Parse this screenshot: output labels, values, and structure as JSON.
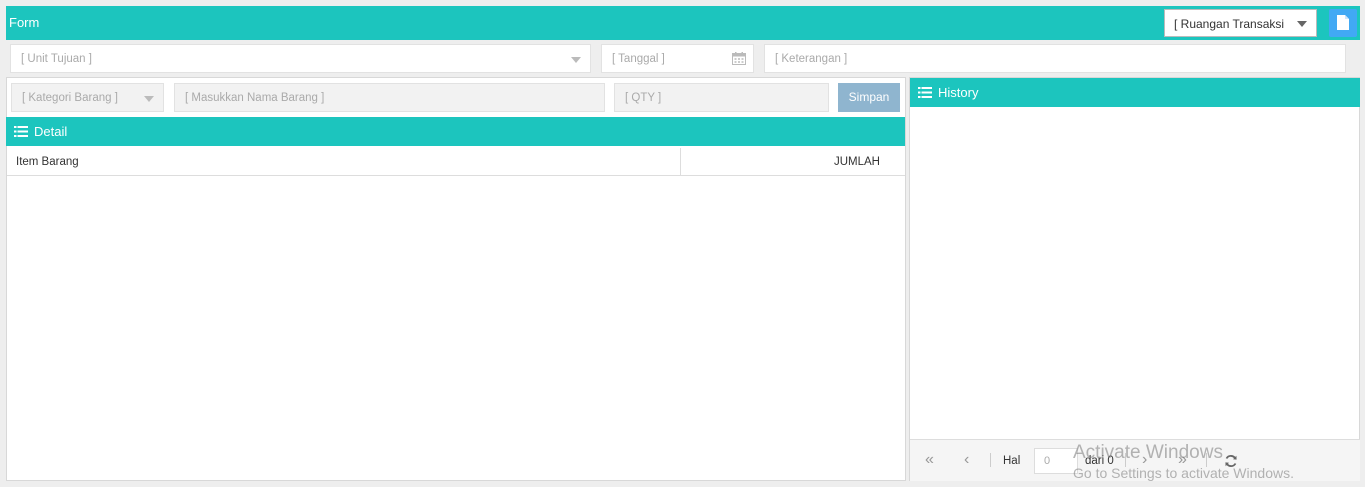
{
  "form": {
    "title": "Form",
    "room_select": "[ Ruangan Transaksi",
    "unit_tujuan_placeholder": "[ Unit Tujuan ]",
    "tanggal_placeholder": "[ Tanggal ]",
    "keterangan_placeholder": "[ Keterangan ]"
  },
  "entry": {
    "kategori_placeholder": "[ Kategori Barang ]",
    "nama_barang_placeholder": "[ Masukkan Nama Barang ]",
    "qty_placeholder": "[ QTY ]",
    "simpan_label": "Simpan"
  },
  "detail": {
    "title": "Detail",
    "columns": [
      "Item Barang",
      "JUMLAH"
    ]
  },
  "history": {
    "title": "History",
    "pager": {
      "hal_label": "Hal",
      "page_value": "0",
      "dari_label": "dari 0"
    }
  },
  "watermark": {
    "line1": "Activate Windows",
    "line2": "Go to Settings to activate Windows."
  },
  "colors": {
    "accent": "#1cc5be",
    "button_blue": "#41a9f4",
    "simpan": "#8fb5cf"
  }
}
